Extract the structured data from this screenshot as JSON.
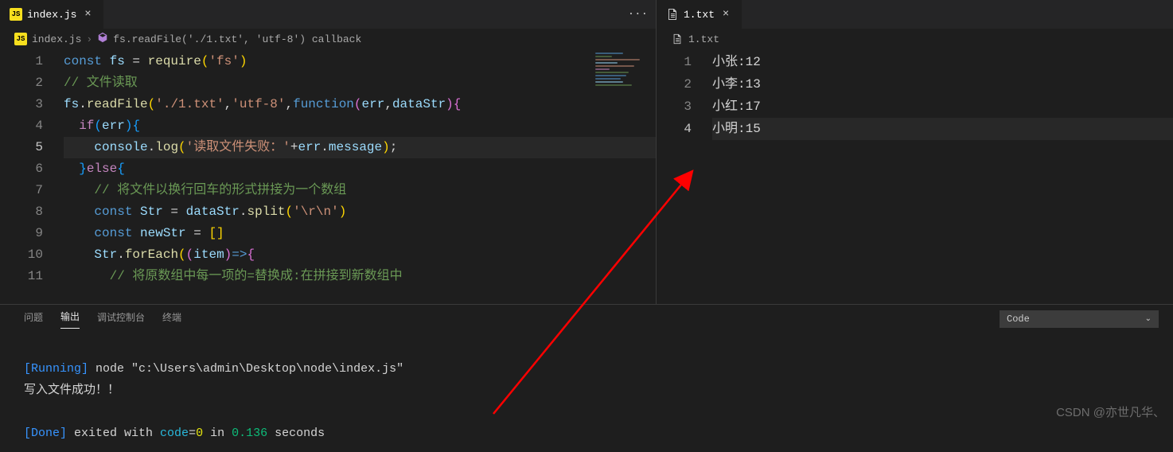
{
  "left": {
    "tab": {
      "label": "index.js",
      "close": "×",
      "icon": "JS"
    },
    "more": "···",
    "breadcrumb": {
      "icon": "JS",
      "file": "index.js",
      "sep": "›",
      "symbol": "fs.readFile('./1.txt', 'utf-8') callback"
    },
    "lines": [
      "1",
      "2",
      "3",
      "4",
      "5",
      "6",
      "7",
      "8",
      "9",
      "10",
      "11"
    ],
    "code": {
      "l1": {
        "a": "const ",
        "b": "fs",
        "c": " = ",
        "d": "require",
        "e": "(",
        "f": "'fs'",
        "g": ")"
      },
      "l2": {
        "a": "// 文件读取"
      },
      "l3": {
        "a": "fs",
        "b": ".",
        "c": "readFile",
        "d": "(",
        "e": "'./1.txt'",
        "f": ",",
        "g": "'utf-8'",
        "h": ",",
        "i": "function",
        "j": "(",
        "k": "err",
        "l": ",",
        "m": "dataStr",
        "n": ")",
        "o": "{"
      },
      "l4": {
        "a": "if",
        "b": "(",
        "c": "err",
        "d": ")",
        "e": "{"
      },
      "l5": {
        "a": "console",
        "b": ".",
        "c": "log",
        "d": "(",
        "e": "'读取文件失败：'",
        "f": "+",
        "g": "err",
        "h": ".",
        "i": "message",
        "j": ")",
        "k": ";"
      },
      "l6": {
        "a": "}",
        "b": "else",
        "c": "{"
      },
      "l7": {
        "a": "// 将文件以换行回车的形式拼接为一个数组"
      },
      "l8": {
        "a": "const ",
        "b": "Str",
        "c": " = ",
        "d": "dataStr",
        "e": ".",
        "f": "split",
        "g": "(",
        "h": "'\\r\\n'",
        "i": ")"
      },
      "l9": {
        "a": "const ",
        "b": "newStr",
        "c": " = ",
        "d": "[",
        "e": "]"
      },
      "l10": {
        "a": "Str",
        "b": ".",
        "c": "forEach",
        "d": "(",
        "e": "(",
        "f": "item",
        "g": ")",
        "h": "=>",
        "i": "{"
      },
      "l11": {
        "a": "// 将原数组中每一项的=替换成:在拼接到新数组中"
      }
    }
  },
  "right": {
    "tab": {
      "label": "1.txt",
      "close": "×"
    },
    "breadcrumb": {
      "file": "1.txt"
    },
    "lines": [
      "1",
      "2",
      "3",
      "4"
    ],
    "content": [
      "小张:12",
      "小李:13",
      "小红:17",
      "小明:15"
    ]
  },
  "panel": {
    "tabs": {
      "problems": "问题",
      "output": "输出",
      "debug": "调试控制台",
      "terminal": "终端"
    },
    "select": "Code",
    "out": {
      "running": "[Running]",
      "cmd": " node \"c:\\Users\\admin\\Desktop\\node\\index.js\"",
      "msg": "写入文件成功！！",
      "done": "[Done]",
      "exit_a": " exited with ",
      "exit_b": "code",
      "exit_c": "=",
      "exit_d": "0",
      "exit_e": " in ",
      "exit_f": "0.136",
      "exit_g": " seconds"
    }
  },
  "watermark": "CSDN @亦世凡华、"
}
